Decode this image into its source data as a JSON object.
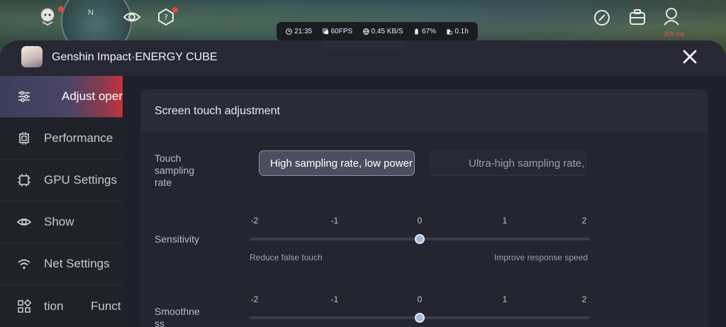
{
  "status_bar": {
    "time": "21:35",
    "fps": "60FPS",
    "network": "0.45 KB/S",
    "battery": "67%",
    "duration": "0.1h"
  },
  "hud": {
    "ping": "309 ms",
    "compass": "N"
  },
  "panel": {
    "title": "Genshin Impact·ENERGY CUBE"
  },
  "sidebar": {
    "items": [
      {
        "label": "Adjust oper",
        "icon": "sliders-icon",
        "active": true
      },
      {
        "label": "Performance",
        "icon": "chip-icon",
        "active": false
      },
      {
        "label": "GPU Settings",
        "icon": "gpu-icon",
        "active": false
      },
      {
        "label": "Show",
        "icon": "eye-icon",
        "active": false
      },
      {
        "label": "Net Settings",
        "icon": "wifi-icon",
        "active": false
      },
      {
        "label": "tion",
        "label2": "Funct",
        "icon": "grid-icon",
        "active": false
      }
    ]
  },
  "content": {
    "section_title": "Screen touch adjustment",
    "sampling": {
      "label_lines": [
        "Touch",
        "sampling",
        "rate"
      ],
      "options": [
        "High sampling rate, low power",
        "Ultra-high sampling rate, l"
      ],
      "selected": 0
    },
    "sensitivity": {
      "label": "Sensitivity",
      "ticks": [
        "-2",
        "-1",
        "0",
        "1",
        "2"
      ],
      "value": 0,
      "min_hint": "Reduce false touch",
      "max_hint": "Improve response speed"
    },
    "smoothness": {
      "label_lines": [
        "Smoothne",
        "ss"
      ],
      "ticks": [
        "-2",
        "-1",
        "0",
        "1",
        "2"
      ],
      "value": 0
    }
  }
}
